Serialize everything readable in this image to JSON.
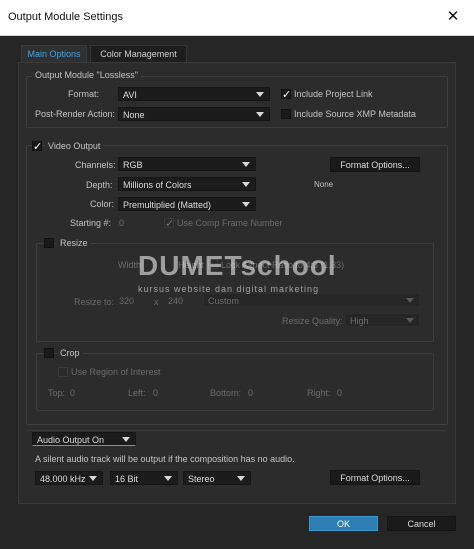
{
  "window": {
    "title": "Output Module Settings",
    "close": "✕"
  },
  "tabs": [
    {
      "label": "Main Options"
    },
    {
      "label": "Color Management"
    }
  ],
  "output_module": {
    "group_title": "Output Module \"Lossless\"",
    "format_label": "Format:",
    "format_value": "AVI",
    "post_render_label": "Post-Render Action:",
    "post_render_value": "None",
    "include_project_link": "Include Project Link",
    "include_xmp": "Include Source XMP Metadata"
  },
  "video": {
    "section_label": "Video Output",
    "channels_label": "Channels:",
    "channels_value": "RGB",
    "depth_label": "Depth:",
    "depth_value": "Millions of Colors",
    "color_label": "Color:",
    "color_value": "Premultiplied (Matted)",
    "format_options": "Format Options...",
    "codec": "None",
    "starting_label": "Starting #:",
    "starting_value": "0",
    "use_comp_frame": "Use Comp Frame Number"
  },
  "resize": {
    "section_label": "Resize",
    "width_label": "Width",
    "height_label": "Height",
    "lock_aspect": "Lock Aspect Ratio to 4:3 (1.33)",
    "resize_to_label": "Resize to:",
    "width_value": "320",
    "times": "x",
    "height_value": "240",
    "preset_value": "Custom",
    "quality_label": "Resize Quality:",
    "quality_value": "High"
  },
  "crop": {
    "section_label": "Crop",
    "use_roi": "Use Region of Interest",
    "top_label": "Top:",
    "top_value": "0",
    "left_label": "Left:",
    "left_value": "0",
    "bottom_label": "Bottom:",
    "bottom_value": "0",
    "right_label": "Right:",
    "right_value": "0"
  },
  "audio": {
    "dropdown_value": "Audio Output On",
    "note": "A silent audio track will be output if the composition has no audio.",
    "rate_value": "48.000 kHz",
    "bits_value": "16 Bit",
    "channels_value": "Stereo",
    "format_options": "Format Options..."
  },
  "watermark": {
    "brand": "DUMETschool",
    "tagline": "kursus website dan digital marketing"
  },
  "footer": {
    "ok": "OK",
    "cancel": "Cancel"
  },
  "colors": {
    "accent_tab": "#3fa2e6",
    "ok_button": "#2d7fb3",
    "background": "#262626"
  }
}
